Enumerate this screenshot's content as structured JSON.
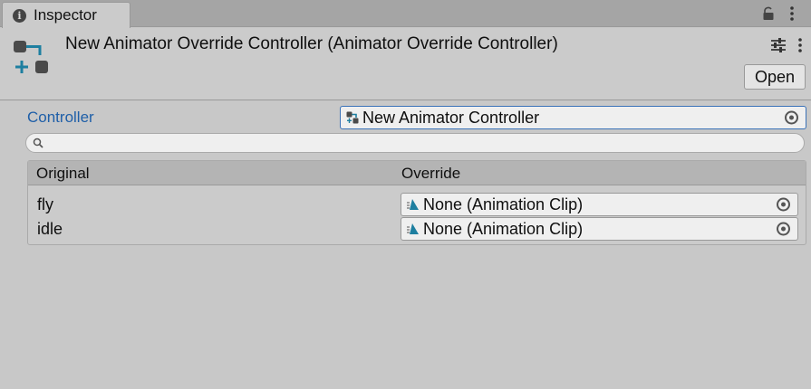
{
  "tab": {
    "label": "Inspector"
  },
  "header": {
    "title": "New Animator Override Controller (Animator Override Controller)",
    "open_label": "Open"
  },
  "controller": {
    "label": "Controller",
    "value": "New Animator Controller"
  },
  "search": {
    "placeholder": ""
  },
  "overrides": {
    "col_original": "Original",
    "col_override": "Override",
    "rows": [
      {
        "original": "fly",
        "override": "None (Animation Clip)"
      },
      {
        "original": "idle",
        "override": "None (Animation Clip)"
      }
    ]
  },
  "colors": {
    "accent": "#1f5fa8",
    "icon_teal": "#1e7fa0"
  },
  "icons": [
    "info-icon",
    "lock-icon",
    "kebab-menu-icon",
    "animator-override-icon",
    "presets-icon",
    "object-picker-icon",
    "animator-controller-icon",
    "search-icon",
    "animation-clip-icon"
  ]
}
